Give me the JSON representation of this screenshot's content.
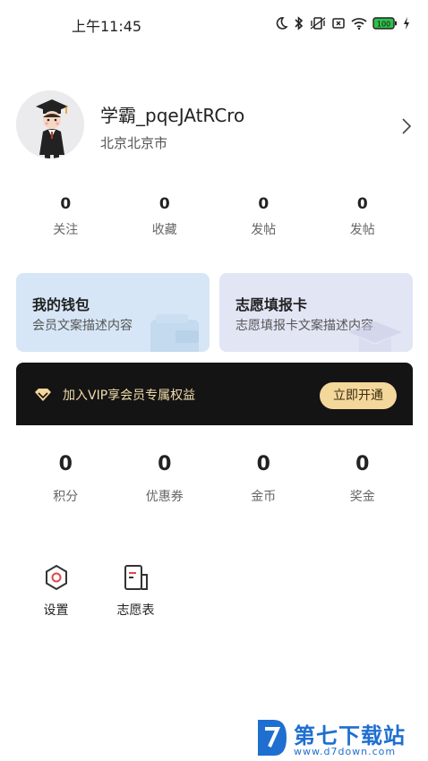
{
  "status_bar": {
    "time": "上午11:45",
    "icons": [
      "moon-icon",
      "bluetooth-icon",
      "vibrate-icon",
      "sim-off-icon",
      "wifi-icon",
      "battery-icon",
      "charging-icon"
    ],
    "battery_color": "#2fbf4a"
  },
  "profile": {
    "username": "学霸_pqeJAtRCro",
    "location": "北京北京市"
  },
  "stats_top": [
    {
      "value": "0",
      "label": "关注"
    },
    {
      "value": "0",
      "label": "收藏"
    },
    {
      "value": "0",
      "label": "发帖"
    },
    {
      "value": "0",
      "label": "发帖"
    }
  ],
  "cards": {
    "wallet": {
      "title": "我的钱包",
      "desc": "会员文案描述内容"
    },
    "volunteer": {
      "title": "志愿填报卡",
      "desc": "志愿填报卡文案描述内容"
    }
  },
  "vip": {
    "text": "加入VIP享会员专属权益",
    "button": "立即开通",
    "accent": "#f4d79a"
  },
  "stats_bottom": [
    {
      "value": "0",
      "label": "积分"
    },
    {
      "value": "0",
      "label": "优惠券"
    },
    {
      "value": "0",
      "label": "金币"
    },
    {
      "value": "0",
      "label": "奖金"
    }
  ],
  "tools": [
    {
      "label": "设置",
      "icon": "settings-hexagon-icon"
    },
    {
      "label": "志愿表",
      "icon": "document-icon"
    }
  ],
  "watermark": {
    "title": "第七下载站",
    "url": "www.d7down.com",
    "color": "#1f6fd0"
  }
}
